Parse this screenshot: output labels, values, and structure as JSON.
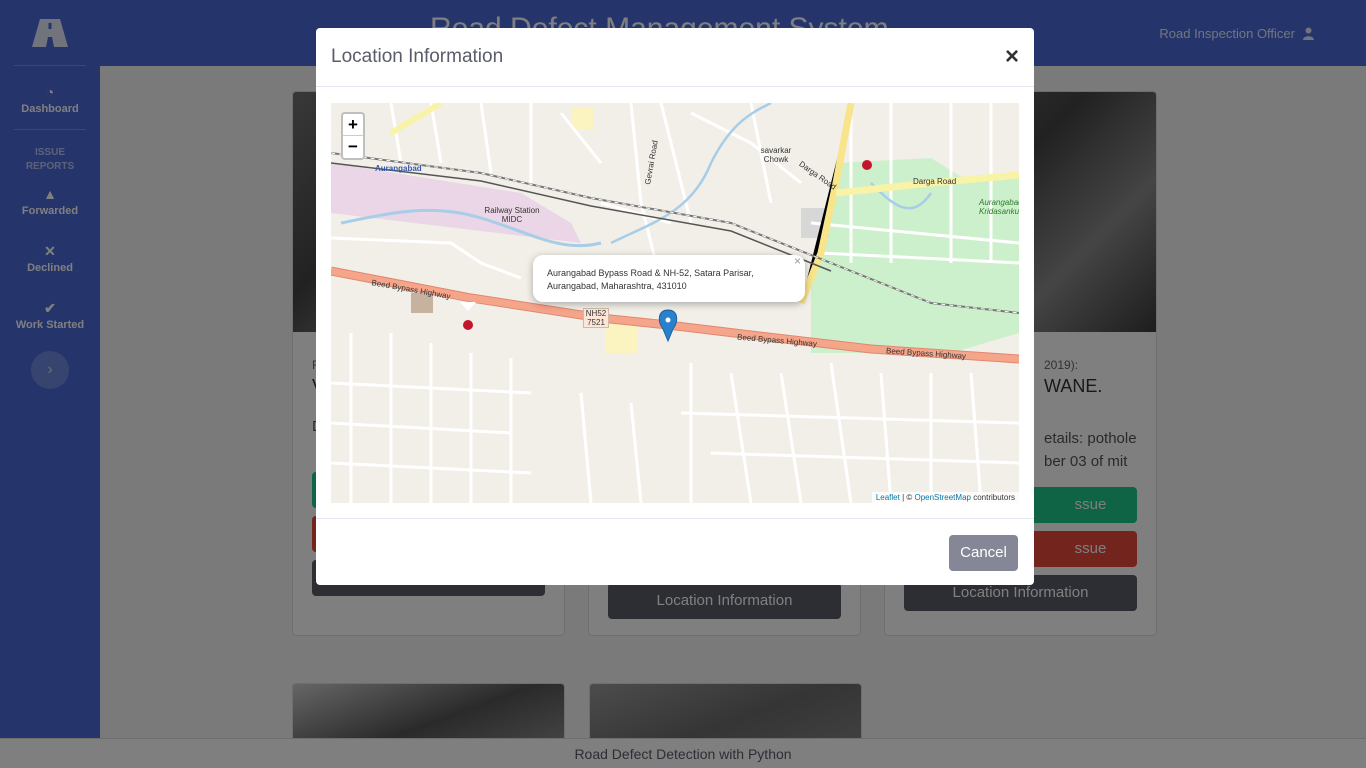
{
  "header": {
    "system_title": "Road Defect Management System",
    "user_role": "Road Inspection Officer"
  },
  "sidebar": {
    "logo": "road-logo-icon",
    "items": [
      {
        "label": "Dashboard",
        "icon": "gauge-icon"
      },
      {
        "label": "Forwarded",
        "icon": "warning-icon"
      },
      {
        "label": "Declined",
        "icon": "close-icon"
      },
      {
        "label": "Work Started",
        "icon": "check-icon"
      }
    ],
    "section_heading": "ISSUE REPORTS"
  },
  "cards": [
    {
      "meta": "R",
      "heading": "V",
      "detail": "D",
      "location_label": "Location Information"
    },
    {
      "location_label": "Location Information"
    },
    {
      "meta": "2019):",
      "heading": "WANE.",
      "detail": "etails: pothole",
      "detail_line2": "ber 03 of mit",
      "forward_label": "ssue",
      "decline_label": "ssue",
      "location_label": "Location Information"
    }
  ],
  "modal": {
    "title": "Location Information",
    "close_symbol": "×",
    "cancel_label": "Cancel",
    "popup_text": "Aurangabad Bypass Road & NH-52, Satara Parisar, Aurangabad, Maharashtra, 431010",
    "popup_close": "×",
    "zoom_in": "+",
    "zoom_out": "−",
    "attribution": {
      "leaflet": "Leaflet",
      "sep": " | © ",
      "osm": "OpenStreetMap",
      "suffix": " contributors"
    },
    "map_labels": {
      "city": "Aurangabad",
      "station": "Railway Station MIDC",
      "bypass_left": "Beed Bypass Highway",
      "bypass_mid": "Beed Bypass Highway",
      "bypass_right": "Beed Bypass Highway",
      "highway_shield": "NH52 7521",
      "chowk": "savarkar Chowk",
      "darga_road": "Darga Road",
      "darga_road_2": "Darga Road",
      "sports": "Aurangabad Kridasanku",
      "gevrai": "Gevrai Road"
    }
  },
  "footer": {
    "text": "Road Defect Detection with Python"
  },
  "colors": {
    "primary": "#4b6bd9",
    "success": "#1cc88a",
    "danger": "#e74a3b",
    "dark": "#5a5c69",
    "highway": "#f4a58a"
  }
}
